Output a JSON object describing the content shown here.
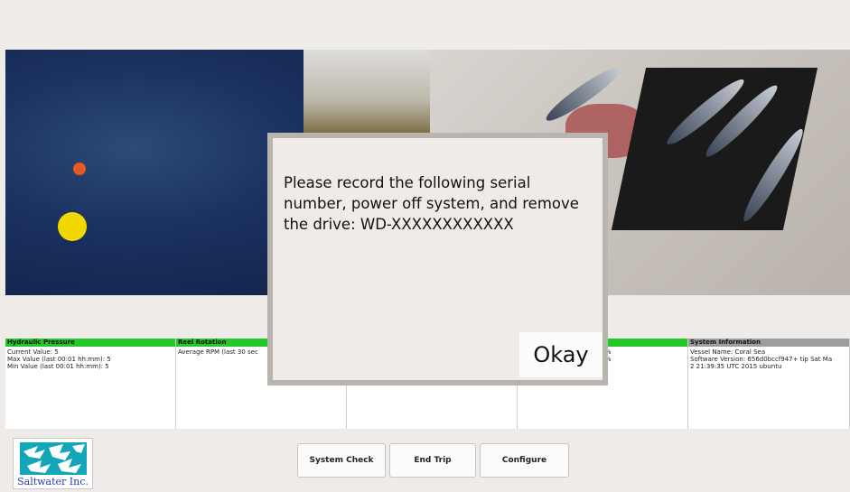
{
  "panels": [
    {
      "title": "Hydraulic Pressure",
      "status": "green",
      "lines": "Current Value: 5\nMax Value (last 00:01 hh:mm): 5\nMin Value (last 00:01 hh:mm): 5"
    },
    {
      "title": "Reel Rotation",
      "status": "green",
      "lines": "Average RPM (last 30 sec"
    },
    {
      "title": "",
      "status": "gray",
      "lines": ""
    },
    {
      "title": "",
      "status": "green",
      "lines": "%\n%"
    },
    {
      "title": "System Information",
      "status": "gray",
      "lines": "Vessel Name: Coral Sea\nSoftware Version: 656d0bccf947+ tip Sat Ma\n2 21:39:35 UTC 2015 ubuntu"
    }
  ],
  "logo": {
    "text": "Saltwater Inc."
  },
  "buttons": {
    "system_check": "System Check",
    "end_trip": "End Trip",
    "configure": "Configure"
  },
  "dialog": {
    "message": "Please record the following serial number, power off system, and remove the drive: WD-XXXXXXXXXXXX",
    "ok_label": "Okay"
  },
  "colors": {
    "ok_status": "#22c728",
    "neutral_status": "#9d9d9d",
    "logo_blue": "#2a3bb0",
    "logo_teal": "#13a6b8"
  }
}
